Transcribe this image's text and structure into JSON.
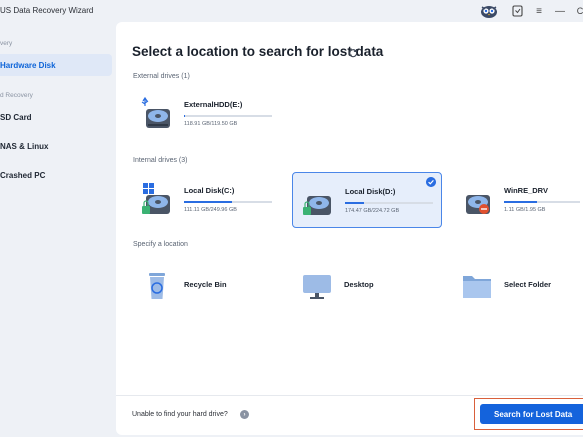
{
  "app": {
    "title": "US Data Recovery Wizard"
  },
  "toolbar": {
    "avatar_icon": "owl-avatar-icon",
    "menu_glyph": "≡",
    "minimize_glyph": "—",
    "extra_glyph": "C"
  },
  "sidebar": {
    "section1": "very",
    "section2": "d Recovery",
    "items": [
      {
        "label": "Hardware Disk",
        "active": true
      },
      {
        "label": "SD Card"
      },
      {
        "label": "NAS & Linux"
      },
      {
        "label": "Crashed PC"
      }
    ]
  },
  "main": {
    "title": "Select a location to search for lost data",
    "external_label": "External drives (1)",
    "internal_label": "Internal drives (3)",
    "location_label": "Specify a location",
    "external_drives": [
      {
        "name": "ExternalHDD(E:)",
        "size": "118.91 GB/119.50 GB",
        "used_fraction": 0.01
      }
    ],
    "internal_drives": [
      {
        "name": "Local Disk(C:)",
        "size": "111.11 GB/249.96 GB",
        "used_fraction": 0.55
      },
      {
        "name": "Local Disk(D:)",
        "size": "174.47 GB/224.72 GB",
        "used_fraction": 0.22,
        "selected": true
      },
      {
        "name": "WinRE_DRV",
        "size": "1.11 GB/1.95 GB",
        "used_fraction": 0.43
      }
    ],
    "locations": [
      {
        "name": "Recycle Bin"
      },
      {
        "name": "Desktop"
      },
      {
        "name": "Select Folder"
      }
    ]
  },
  "footer": {
    "help_text": "Unable to find your hard drive?",
    "search_button": "Search for Lost Data"
  },
  "colors": {
    "accent": "#1463dc",
    "highlight_border": "#d9603b",
    "selected_bg": "#e6eefb"
  }
}
